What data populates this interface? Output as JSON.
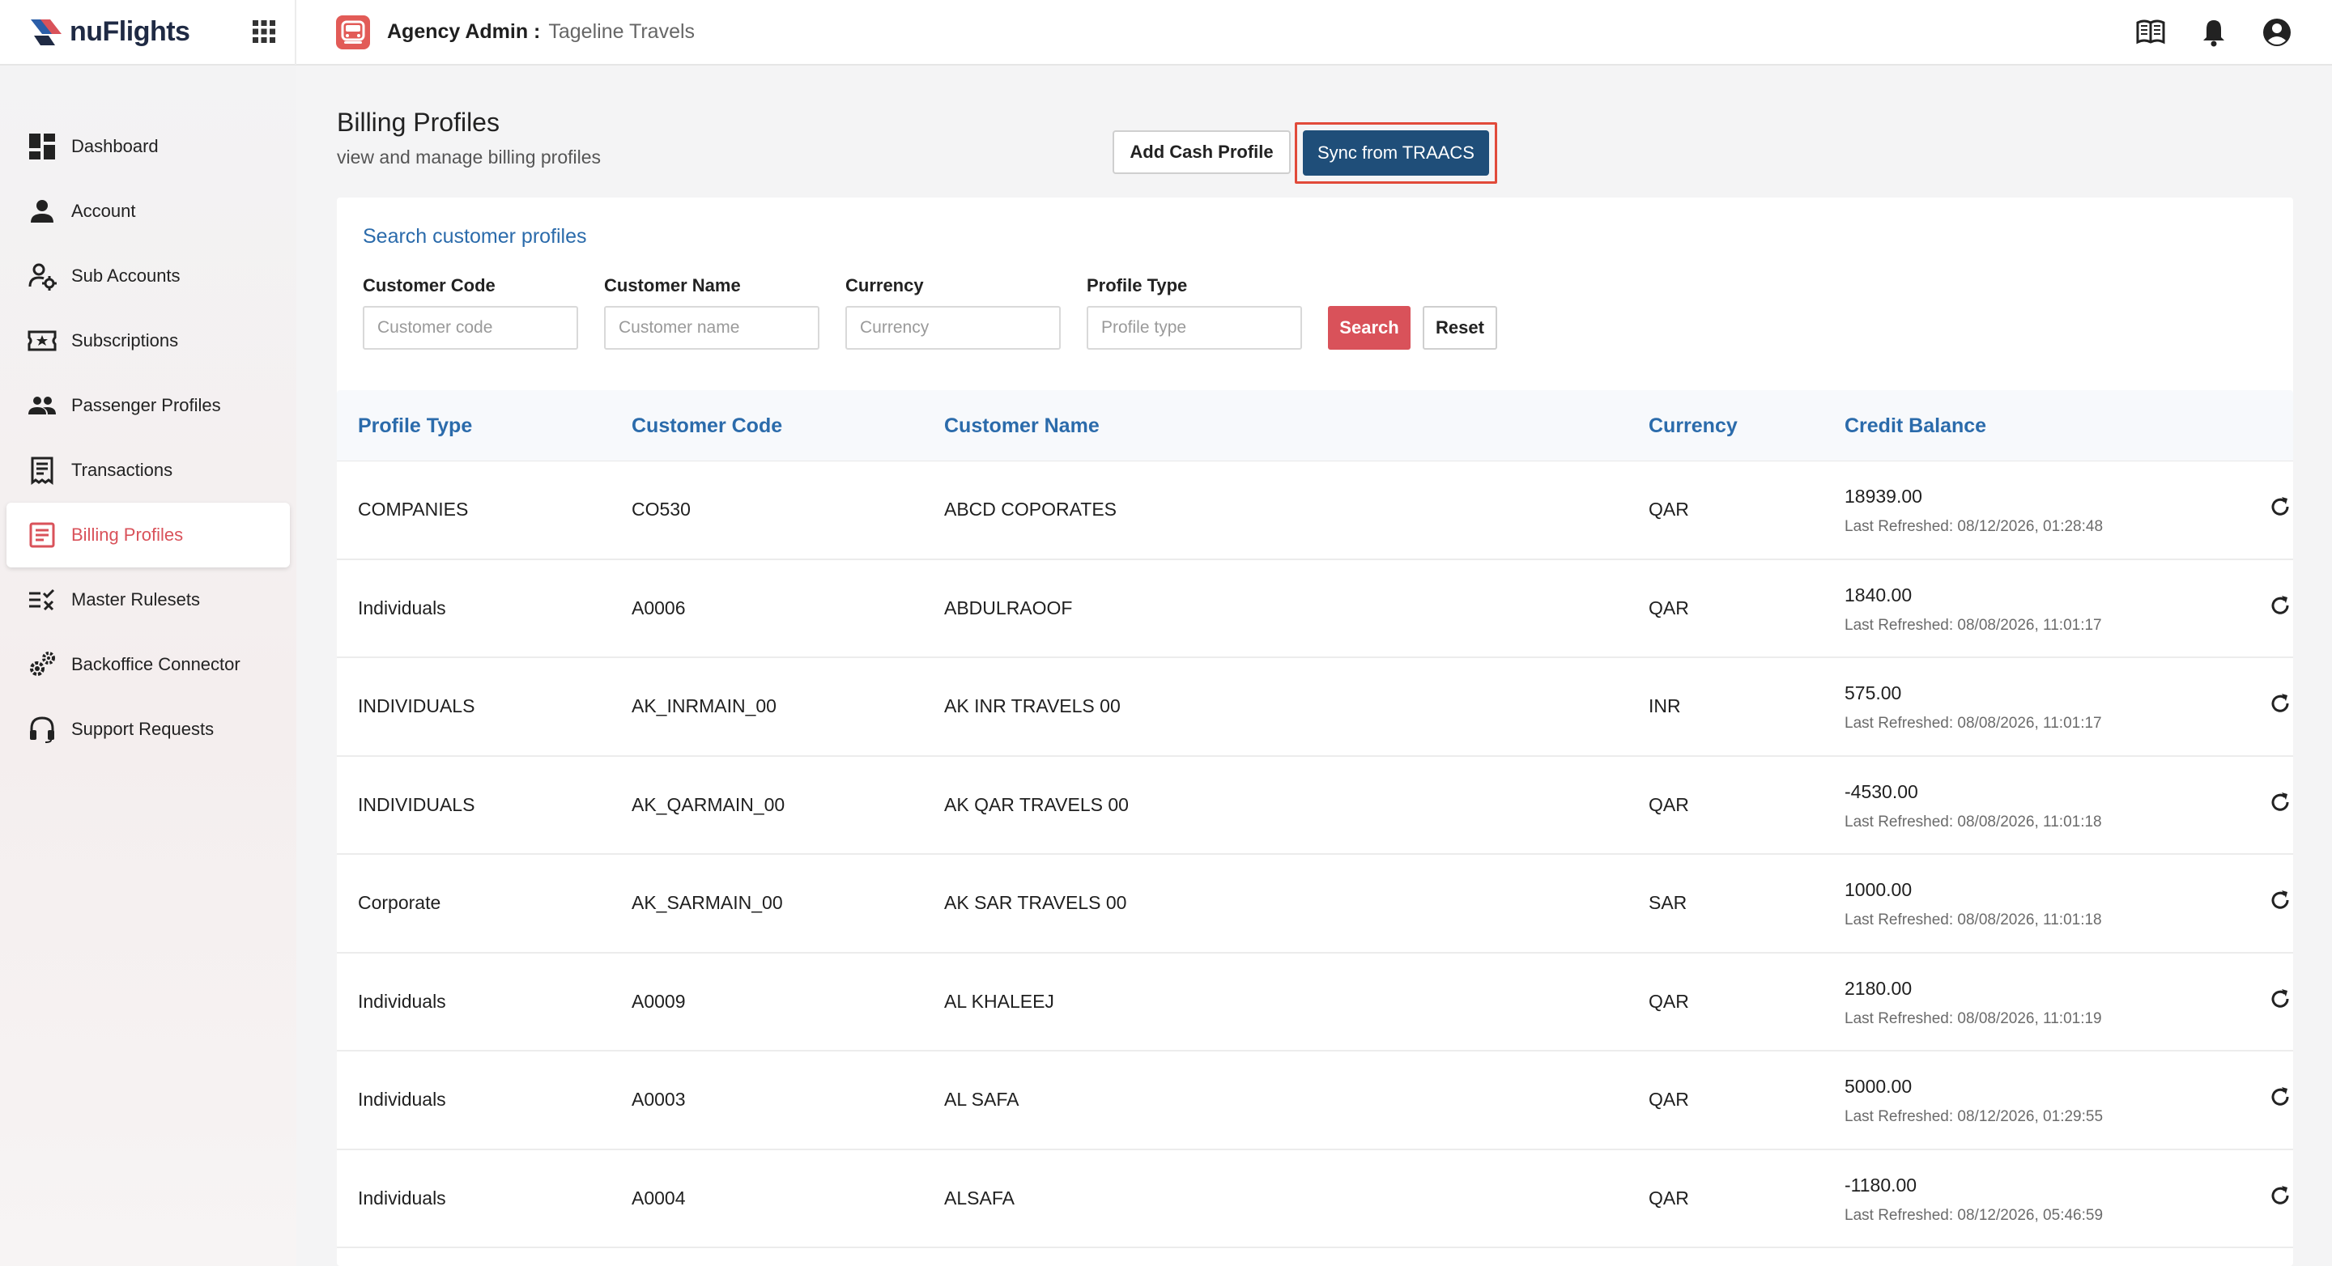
{
  "header": {
    "logo_text": "nuFlights",
    "title": "Agency Admin :",
    "agency_name": "Tageline Travels"
  },
  "sidebar": {
    "items": [
      {
        "label": "Dashboard",
        "icon": "dashboard-icon"
      },
      {
        "label": "Account",
        "icon": "person-icon"
      },
      {
        "label": "Sub Accounts",
        "icon": "user-gear-icon"
      },
      {
        "label": "Subscriptions",
        "icon": "ticket-star-icon"
      },
      {
        "label": "Passenger Profiles",
        "icon": "people-icon"
      },
      {
        "label": "Transactions",
        "icon": "receipt-icon"
      },
      {
        "label": "Billing Profiles",
        "icon": "billing-list-icon",
        "active": true
      },
      {
        "label": "Master Rulesets",
        "icon": "rules-check-icon"
      },
      {
        "label": "Backoffice Connector",
        "icon": "gears-icon"
      },
      {
        "label": "Support Requests",
        "icon": "headset-icon"
      }
    ]
  },
  "page": {
    "title": "Billing Profiles",
    "subtitle": "view and manage billing profiles",
    "add_cash_label": "Add Cash Profile",
    "sync_label": "Sync from TRAACS"
  },
  "search": {
    "title": "Search customer profiles",
    "fields": [
      {
        "label": "Customer Code",
        "placeholder": "Customer code"
      },
      {
        "label": "Customer Name",
        "placeholder": "Customer name"
      },
      {
        "label": "Currency",
        "placeholder": "Currency"
      },
      {
        "label": "Profile Type",
        "placeholder": "Profile type"
      }
    ],
    "search_label": "Search",
    "reset_label": "Reset"
  },
  "table": {
    "columns": [
      "Profile Type",
      "Customer Code",
      "Customer Name",
      "Currency",
      "Credit Balance"
    ],
    "rows": [
      {
        "type": "COMPANIES",
        "code": "CO530",
        "name": "ABCD COPORATES",
        "currency": "QAR",
        "balance": "18939.00",
        "refreshed": "Last Refreshed: 08/12/2026, 01:28:48"
      },
      {
        "type": "Individuals",
        "code": "A0006",
        "name": "ABDULRAOOF",
        "currency": "QAR",
        "balance": "1840.00",
        "refreshed": "Last Refreshed: 08/08/2026, 11:01:17"
      },
      {
        "type": "INDIVIDUALS",
        "code": "AK_INRMAIN_00",
        "name": "AK INR TRAVELS 00",
        "currency": "INR",
        "balance": "575.00",
        "refreshed": "Last Refreshed: 08/08/2026, 11:01:17"
      },
      {
        "type": "INDIVIDUALS",
        "code": "AK_QARMAIN_00",
        "name": "AK QAR TRAVELS 00",
        "currency": "QAR",
        "balance": "-4530.00",
        "refreshed": "Last Refreshed: 08/08/2026, 11:01:18"
      },
      {
        "type": "Corporate",
        "code": "AK_SARMAIN_00",
        "name": "AK SAR TRAVELS 00",
        "currency": "SAR",
        "balance": "1000.00",
        "refreshed": "Last Refreshed: 08/08/2026, 11:01:18"
      },
      {
        "type": "Individuals",
        "code": "A0009",
        "name": "AL KHALEEJ",
        "currency": "QAR",
        "balance": "2180.00",
        "refreshed": "Last Refreshed: 08/08/2026, 11:01:19"
      },
      {
        "type": "Individuals",
        "code": "A0003",
        "name": "AL SAFA",
        "currency": "QAR",
        "balance": "5000.00",
        "refreshed": "Last Refreshed: 08/12/2026, 01:29:55"
      },
      {
        "type": "Individuals",
        "code": "A0004",
        "name": "ALSAFA",
        "currency": "QAR",
        "balance": "-1180.00",
        "refreshed": "Last Refreshed: 08/12/2026, 05:46:59"
      }
    ]
  },
  "colors": {
    "accent_red": "#d9525a",
    "brand_blue": "#1f4e79",
    "link_blue": "#2b6bab",
    "highlight_outline": "#e14a3a"
  }
}
